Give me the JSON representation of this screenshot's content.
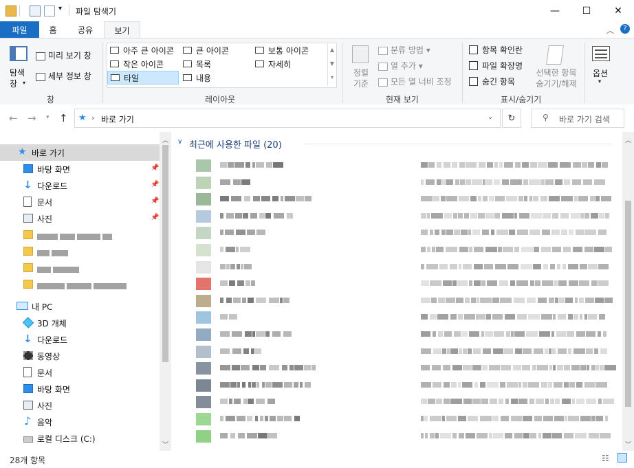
{
  "window": {
    "title": "파일 탐색기",
    "minimize": "—",
    "maximize": "☐",
    "close": "✕"
  },
  "tabs": [
    {
      "label": "파일",
      "active": false
    },
    {
      "label": "홈",
      "active": false
    },
    {
      "label": "공유",
      "active": false
    },
    {
      "label": "보기",
      "active": true
    }
  ],
  "ribbon": {
    "pane": {
      "nav_pane_label": "탐색\n창",
      "preview_label": "미리 보기 창",
      "details_label": "세부 정보 창",
      "group": "창"
    },
    "layout": {
      "items": [
        "아주 큰 아이콘",
        "큰 아이콘",
        "보통 아이콘",
        "작은 아이콘",
        "목록",
        "자세히",
        "타일",
        "내용"
      ],
      "selected": "타일",
      "group": "레이아웃"
    },
    "current_view": {
      "sort_label": "정렬 기준",
      "group_by": "분류 방법",
      "add_column": "열 추가",
      "fit_columns": "모든 열 너비 조정",
      "group": "현재 보기"
    },
    "show_hide": {
      "item_checkboxes": "항목 확인란",
      "file_extensions": "파일 확장명",
      "hidden_items": "숨긴 항목",
      "hide_selected": "선택한 항목 숨기기/해제",
      "group": "표시/숨기기"
    },
    "options": {
      "label": "옵션"
    }
  },
  "address": {
    "path": "바로 가기",
    "search_placeholder": "바로 가기 검색"
  },
  "nav": {
    "quick_access": "바로 가기",
    "pinned": [
      {
        "label": "바탕 화면",
        "icon": "desktop-icon"
      },
      {
        "label": "다운로드",
        "icon": "download-icon"
      },
      {
        "label": "문서",
        "icon": "document-icon"
      },
      {
        "label": "사진",
        "icon": "picture-icon"
      }
    ],
    "this_pc": "내 PC",
    "pc_items": [
      {
        "label": "3D 개체",
        "icon": "3d-objects-icon"
      },
      {
        "label": "다운로드",
        "icon": "download-icon"
      },
      {
        "label": "동영상",
        "icon": "video-icon"
      },
      {
        "label": "문서",
        "icon": "document-icon"
      },
      {
        "label": "바탕 화면",
        "icon": "desktop-icon"
      },
      {
        "label": "사진",
        "icon": "picture-icon"
      },
      {
        "label": "음악",
        "icon": "music-icon"
      },
      {
        "label": "로컬 디스크 (C:)",
        "icon": "drive-icon"
      }
    ]
  },
  "content": {
    "group_header": "최근에 사용한 파일 (20)"
  },
  "status": {
    "item_count": "28개 항목"
  },
  "colors": {
    "accent": "#1a6fc4",
    "ribbon_bg": "#f5f6f7",
    "selected": "#cce8ff"
  }
}
